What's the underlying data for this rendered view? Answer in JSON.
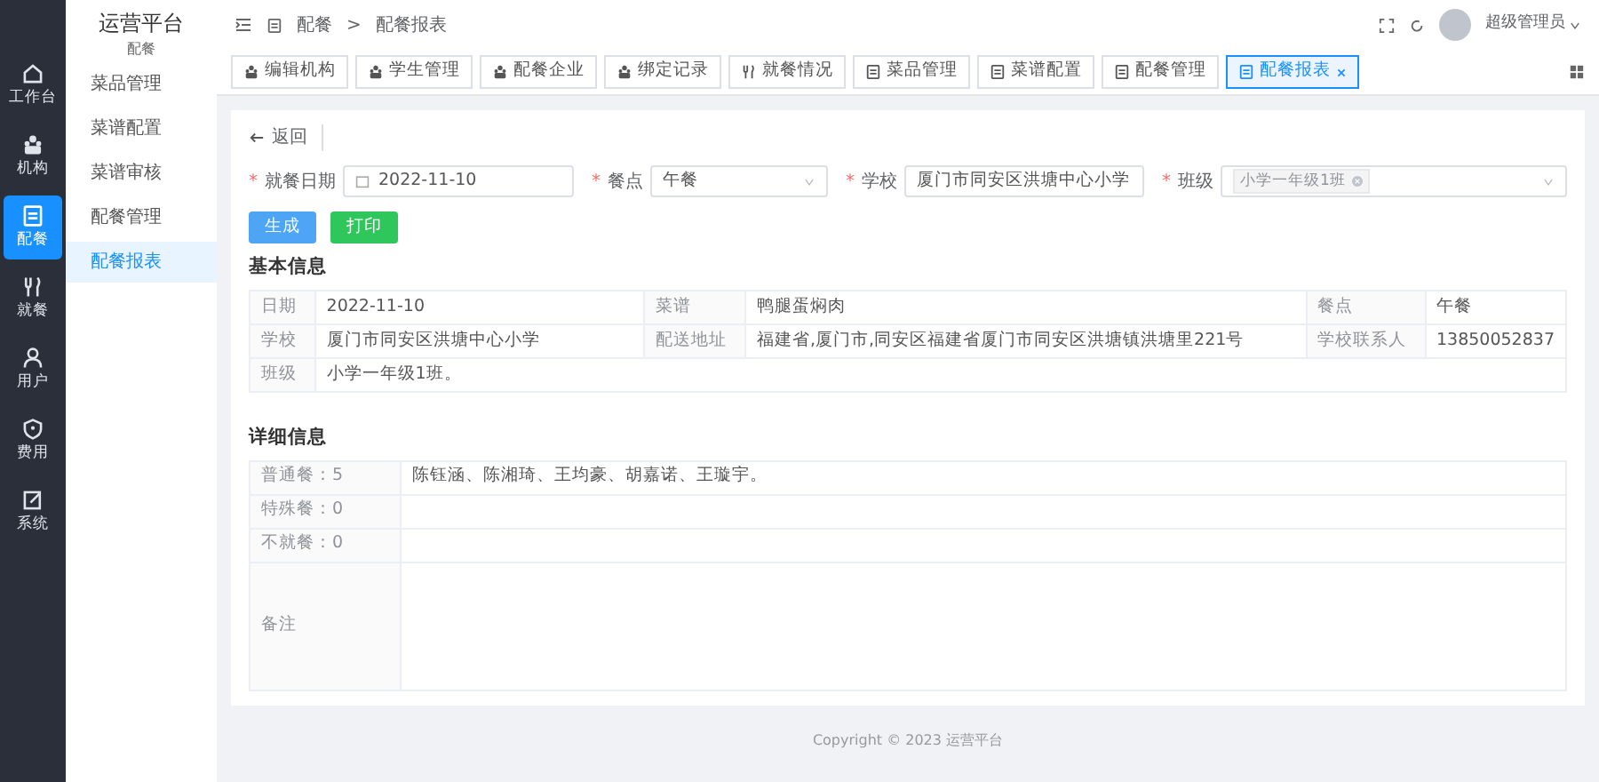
{
  "app": {
    "title": "运营平台",
    "subtitle": "配餐"
  },
  "rail": [
    {
      "label": "工作台",
      "selected": false
    },
    {
      "label": "机构",
      "selected": false
    },
    {
      "label": "配餐",
      "selected": true
    },
    {
      "label": "就餐",
      "selected": false
    },
    {
      "label": "用户",
      "selected": false
    },
    {
      "label": "费用",
      "selected": false
    },
    {
      "label": "系统",
      "selected": false
    }
  ],
  "submenu": [
    {
      "label": "菜品管理",
      "selected": false
    },
    {
      "label": "菜谱配置",
      "selected": false
    },
    {
      "label": "菜谱审核",
      "selected": false
    },
    {
      "label": "配餐管理",
      "selected": false
    },
    {
      "label": "配餐报表",
      "selected": true
    }
  ],
  "breadcrumb": {
    "items": [
      "配餐",
      "配餐报表"
    ],
    "separator": ">"
  },
  "user": {
    "name": "超级管理员"
  },
  "tabs": [
    {
      "label": "编辑机构",
      "selected": false,
      "closable": false
    },
    {
      "label": "学生管理",
      "selected": false,
      "closable": false
    },
    {
      "label": "配餐企业",
      "selected": false,
      "closable": false
    },
    {
      "label": "绑定记录",
      "selected": false,
      "closable": false
    },
    {
      "label": "就餐情况",
      "selected": false,
      "closable": false
    },
    {
      "label": "菜品管理",
      "selected": false,
      "closable": false
    },
    {
      "label": "菜谱配置",
      "selected": false,
      "closable": false
    },
    {
      "label": "配餐管理",
      "selected": false,
      "closable": false
    },
    {
      "label": "配餐报表",
      "selected": true,
      "closable": true
    }
  ],
  "required_mark": "*",
  "back": "返回",
  "filters": [
    {
      "label": "就餐日期",
      "kind": "date",
      "value": "2022-11-10",
      "required": true
    },
    {
      "label": "餐点",
      "kind": "select",
      "value": "午餐",
      "required": true
    },
    {
      "label": "学校",
      "kind": "select",
      "value": "厦门市同安区洪塘中心小学",
      "required": true
    },
    {
      "label": "班级",
      "kind": "tags",
      "tags": [
        "小学一年级1班"
      ],
      "required": true
    }
  ],
  "buttons": [
    {
      "label": "生成",
      "kind": "primary"
    },
    {
      "label": "打印",
      "kind": "success"
    }
  ],
  "basic": {
    "title": "基本信息",
    "rows": [
      [
        {
          "label": "日期",
          "value": "2022-11-10"
        },
        {
          "label": "菜谱",
          "value": "鸭腿蛋焖肉"
        },
        {
          "label": "餐点",
          "value": "午餐"
        }
      ],
      [
        {
          "label": "学校",
          "value": "厦门市同安区洪塘中心小学"
        },
        {
          "label": "配送地址",
          "value": "福建省,厦门市,同安区福建省厦门市同安区洪塘镇洪塘里221号"
        },
        {
          "label": "学校联系人",
          "value": "13850052837"
        }
      ],
      [
        {
          "label": "班级",
          "value": "小学一年级1班。"
        }
      ]
    ]
  },
  "detail": {
    "title": "详细信息",
    "rows": [
      {
        "label": "普通餐：5",
        "value": "陈钰涵、陈湘琦、王均豪、胡嘉诺、王璇宇。",
        "kind": "line"
      },
      {
        "label": "特殊餐：0",
        "kind": "line"
      },
      {
        "label": "不就餐：0",
        "kind": "line"
      },
      {
        "label": "备注",
        "kind": "area"
      }
    ]
  },
  "footer": "Copyright © 2023 运营平台"
}
